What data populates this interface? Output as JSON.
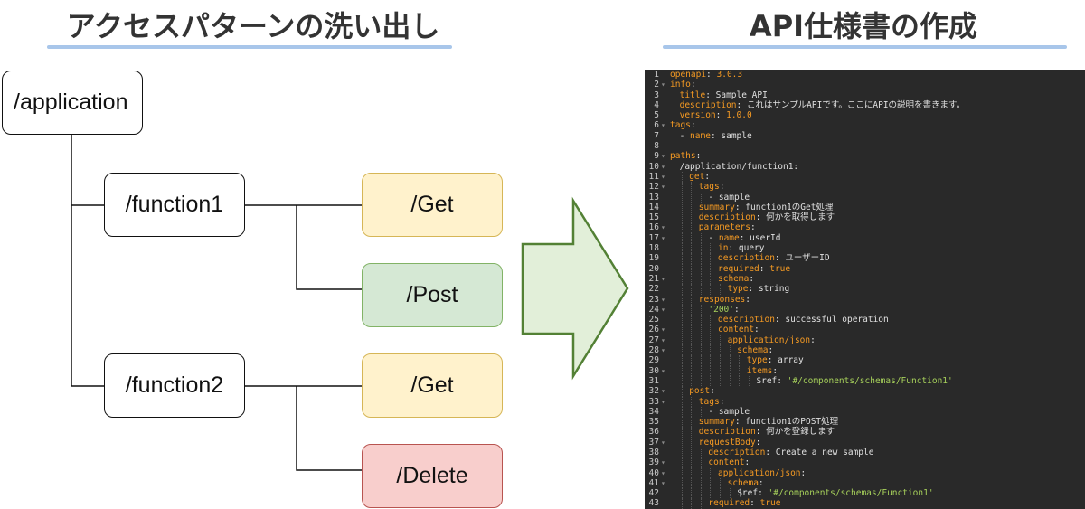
{
  "left_heading": "アクセスパターンの洗い出し",
  "right_heading": "API仕様書の作成",
  "tree": {
    "root": "/application",
    "functions": [
      {
        "label": "/function1",
        "methods": [
          {
            "label": "/Get",
            "color": "#fff2cc",
            "border": "#d6b656"
          },
          {
            "label": "/Post",
            "color": "#d5e8d4",
            "border": "#82b366"
          }
        ]
      },
      {
        "label": "/function2",
        "methods": [
          {
            "label": "/Get",
            "color": "#fff2cc",
            "border": "#d6b656"
          },
          {
            "label": "/Delete",
            "color": "#f8cecc",
            "border": "#b85450"
          }
        ]
      }
    ]
  },
  "arrow": {
    "fill": "#e2efd9",
    "stroke": "#538135"
  },
  "spec_lines": [
    [
      0,
      [
        [
          "k",
          "openapi"
        ],
        [
          "v",
          ": "
        ],
        [
          "k",
          "3.0.3"
        ]
      ]
    ],
    [
      0,
      [
        [
          "k",
          "info"
        ],
        [
          "v",
          ":"
        ]
      ]
    ],
    [
      1,
      [
        [
          "k",
          "title"
        ],
        [
          "v",
          ": Sample API"
        ]
      ]
    ],
    [
      1,
      [
        [
          "k",
          "description"
        ],
        [
          "v",
          ": これはサンプルAPIです。ここにAPIの説明を書きます。"
        ]
      ]
    ],
    [
      1,
      [
        [
          "k",
          "version"
        ],
        [
          "v",
          ": "
        ],
        [
          "k",
          "1.0.0"
        ]
      ]
    ],
    [
      0,
      [
        [
          "k",
          "tags"
        ],
        [
          "v",
          ":"
        ]
      ]
    ],
    [
      1,
      [
        [
          "v",
          "- "
        ],
        [
          "k",
          "name"
        ],
        [
          "v",
          ": sample"
        ]
      ]
    ],
    [
      0,
      []
    ],
    [
      0,
      [
        [
          "k",
          "paths"
        ],
        [
          "v",
          ":"
        ]
      ]
    ],
    [
      1,
      [
        [
          "v",
          "/application/function1:"
        ]
      ]
    ],
    [
      2,
      [
        [
          "k",
          "get"
        ],
        [
          "v",
          ":"
        ]
      ]
    ],
    [
      3,
      [
        [
          "k",
          "tags"
        ],
        [
          "v",
          ":"
        ]
      ]
    ],
    [
      4,
      [
        [
          "v",
          "- sample"
        ]
      ]
    ],
    [
      3,
      [
        [
          "k",
          "summary"
        ],
        [
          "v",
          ": function1のGet処理"
        ]
      ]
    ],
    [
      3,
      [
        [
          "k",
          "description"
        ],
        [
          "v",
          ": 何かを取得します"
        ]
      ]
    ],
    [
      3,
      [
        [
          "k",
          "parameters"
        ],
        [
          "v",
          ":"
        ]
      ]
    ],
    [
      4,
      [
        [
          "v",
          "- "
        ],
        [
          "k",
          "name"
        ],
        [
          "v",
          ": userId"
        ]
      ]
    ],
    [
      5,
      [
        [
          "k",
          "in"
        ],
        [
          "v",
          ": query"
        ]
      ]
    ],
    [
      5,
      [
        [
          "k",
          "description"
        ],
        [
          "v",
          ": ユーザーID"
        ]
      ]
    ],
    [
      5,
      [
        [
          "k",
          "required"
        ],
        [
          "v",
          ": "
        ],
        [
          "k",
          "true"
        ]
      ]
    ],
    [
      5,
      [
        [
          "k",
          "schema"
        ],
        [
          "v",
          ":"
        ]
      ]
    ],
    [
      6,
      [
        [
          "k",
          "type"
        ],
        [
          "v",
          ": string"
        ]
      ]
    ],
    [
      3,
      [
        [
          "k",
          "responses"
        ],
        [
          "v",
          ":"
        ]
      ]
    ],
    [
      4,
      [
        [
          "s",
          "'200'"
        ],
        [
          "v",
          ":"
        ]
      ]
    ],
    [
      5,
      [
        [
          "k",
          "description"
        ],
        [
          "v",
          ": successful operation"
        ]
      ]
    ],
    [
      5,
      [
        [
          "k",
          "content"
        ],
        [
          "v",
          ":"
        ]
      ]
    ],
    [
      6,
      [
        [
          "k",
          "application/json"
        ],
        [
          "v",
          ":"
        ]
      ]
    ],
    [
      7,
      [
        [
          "k",
          "schema"
        ],
        [
          "v",
          ":"
        ]
      ]
    ],
    [
      8,
      [
        [
          "k",
          "type"
        ],
        [
          "v",
          ": array"
        ]
      ]
    ],
    [
      8,
      [
        [
          "k",
          "items"
        ],
        [
          "v",
          ":"
        ]
      ]
    ],
    [
      9,
      [
        [
          "v",
          "$ref: "
        ],
        [
          "s",
          "'#/components/schemas/Function1'"
        ]
      ]
    ],
    [
      2,
      [
        [
          "k",
          "post"
        ],
        [
          "v",
          ":"
        ]
      ]
    ],
    [
      3,
      [
        [
          "k",
          "tags"
        ],
        [
          "v",
          ":"
        ]
      ]
    ],
    [
      4,
      [
        [
          "v",
          "- sample"
        ]
      ]
    ],
    [
      3,
      [
        [
          "k",
          "summary"
        ],
        [
          "v",
          ": function1のPOST処理"
        ]
      ]
    ],
    [
      3,
      [
        [
          "k",
          "description"
        ],
        [
          "v",
          ": 何かを登録します"
        ]
      ]
    ],
    [
      3,
      [
        [
          "k",
          "requestBody"
        ],
        [
          "v",
          ":"
        ]
      ]
    ],
    [
      4,
      [
        [
          "k",
          "description"
        ],
        [
          "v",
          ": Create a new sample"
        ]
      ]
    ],
    [
      4,
      [
        [
          "k",
          "content"
        ],
        [
          "v",
          ":"
        ]
      ]
    ],
    [
      5,
      [
        [
          "k",
          "application/json"
        ],
        [
          "v",
          ":"
        ]
      ]
    ],
    [
      6,
      [
        [
          "k",
          "schema"
        ],
        [
          "v",
          ":"
        ]
      ]
    ],
    [
      7,
      [
        [
          "v",
          "$ref: "
        ],
        [
          "s",
          "'#/components/schemas/Function1'"
        ]
      ]
    ],
    [
      4,
      [
        [
          "k",
          "required"
        ],
        [
          "v",
          ": "
        ],
        [
          "k",
          "true"
        ]
      ]
    ]
  ]
}
